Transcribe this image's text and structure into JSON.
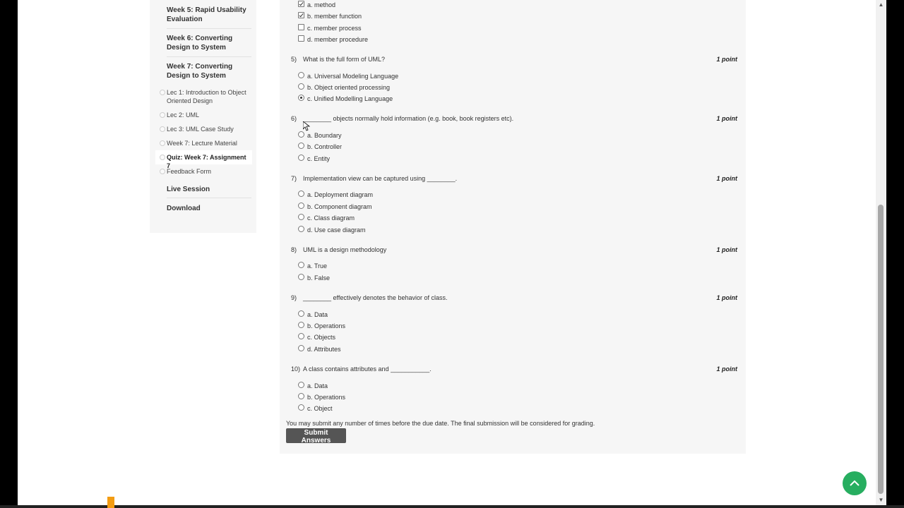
{
  "sidebar": {
    "weeks": [
      {
        "id": "week5",
        "label": "Week 5: Rapid Usability Evaluation"
      },
      {
        "id": "week6",
        "label": "Week 6: Converting Design to System"
      },
      {
        "id": "week7",
        "label": "Week 7: Converting Design to System"
      }
    ],
    "lectures": [
      {
        "label": "Lec 1: Introduction to Object Oriented Design",
        "active": false
      },
      {
        "label": "Lec 2: UML",
        "active": false
      },
      {
        "label": "Lec 3: UML Case Study",
        "active": false
      },
      {
        "label": "Week 7: Lecture Material",
        "active": false
      },
      {
        "label": "Quiz: Week 7: Assignment 7",
        "active": true
      },
      {
        "label": "Feedback Form",
        "active": false
      }
    ],
    "extras": [
      {
        "label": "Live Session"
      },
      {
        "label": "Download"
      }
    ]
  },
  "quiz": {
    "prev_options": [
      {
        "label": "a. method",
        "checked": true
      },
      {
        "label": "b. member function",
        "checked": true
      },
      {
        "label": "c. member process",
        "checked": false
      },
      {
        "label": "d. member procedure",
        "checked": false
      }
    ],
    "questions": [
      {
        "num": "5)",
        "text": "What is the full form of UML?",
        "points": "1 point",
        "options": [
          {
            "label": "a. Universal Modeling Language",
            "selected": false
          },
          {
            "label": "b. Object oriented processing",
            "selected": false
          },
          {
            "label": "c. Unified Modelling Language",
            "selected": true
          }
        ]
      },
      {
        "num": "6)",
        "text": "________ objects normally hold information (e.g. book, book registers etc).",
        "points": "1 point",
        "options": [
          {
            "label": "a. Boundary",
            "selected": false
          },
          {
            "label": "b. Controller",
            "selected": false
          },
          {
            "label": "c. Entity",
            "selected": false
          }
        ]
      },
      {
        "num": "7)",
        "text": "Implementation view can be captured using ________.",
        "points": "1 point",
        "options": [
          {
            "label": "a. Deployment diagram",
            "selected": false
          },
          {
            "label": "b. Component diagram",
            "selected": false
          },
          {
            "label": "c. Class diagram",
            "selected": false
          },
          {
            "label": "d. Use case diagram",
            "selected": false
          }
        ]
      },
      {
        "num": "8)",
        "text": "UML is a design methodology",
        "points": "1 point",
        "options": [
          {
            "label": "a. True",
            "selected": false
          },
          {
            "label": "b. False",
            "selected": false
          }
        ]
      },
      {
        "num": "9)",
        "text": "________ effectively denotes the behavior of class.",
        "points": "1 point",
        "options": [
          {
            "label": "a. Data",
            "selected": false
          },
          {
            "label": "b. Operations",
            "selected": false
          },
          {
            "label": "c. Objects",
            "selected": false
          },
          {
            "label": "d. Attributes",
            "selected": false
          }
        ]
      },
      {
        "num": "10)",
        "text": "A class contains attributes and ___________.",
        "points": "1 point",
        "options": [
          {
            "label": "a. Data",
            "selected": false
          },
          {
            "label": "b. Operations",
            "selected": false
          },
          {
            "label": "c. Object",
            "selected": false
          }
        ]
      }
    ],
    "note": "You may submit any number of times before the due date. The final submission will be considered for grading.",
    "submit_label": "Submit Answers"
  },
  "colors": {
    "accent_green": "#27ae60",
    "submit_bg": "#555555",
    "marker_orange": "#f39c12"
  },
  "icons": {
    "scroll_top": "chevron-up-icon",
    "checkbox": "checkbox-icon",
    "radio": "radio-icon"
  }
}
